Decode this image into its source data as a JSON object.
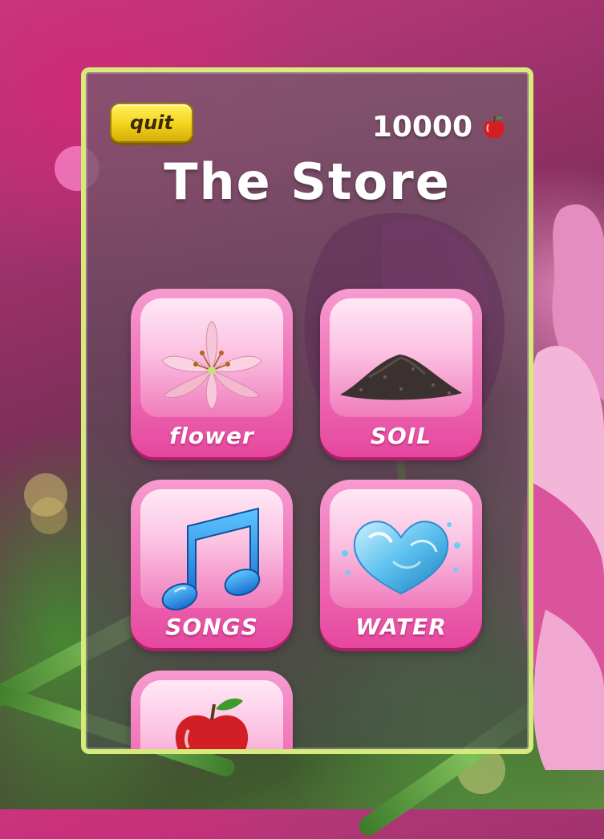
{
  "header": {
    "quit_label": "quit",
    "score": "10000",
    "currency_icon": "apple-icon",
    "title": "The Store"
  },
  "store_items": [
    {
      "label": "flower",
      "icon": "lily-flower-icon"
    },
    {
      "label": "SOIL",
      "icon": "soil-pile-icon"
    },
    {
      "label": "SONGS",
      "icon": "music-note-icon"
    },
    {
      "label": "WATER",
      "icon": "water-heart-icon"
    },
    {
      "label": "",
      "icon": "apple-icon"
    }
  ],
  "colors": {
    "panel_border": "#d7eb7a",
    "tile_pink": "#e6479e",
    "quit_yellow": "#f2d21b",
    "title_text": "#ffffff"
  }
}
